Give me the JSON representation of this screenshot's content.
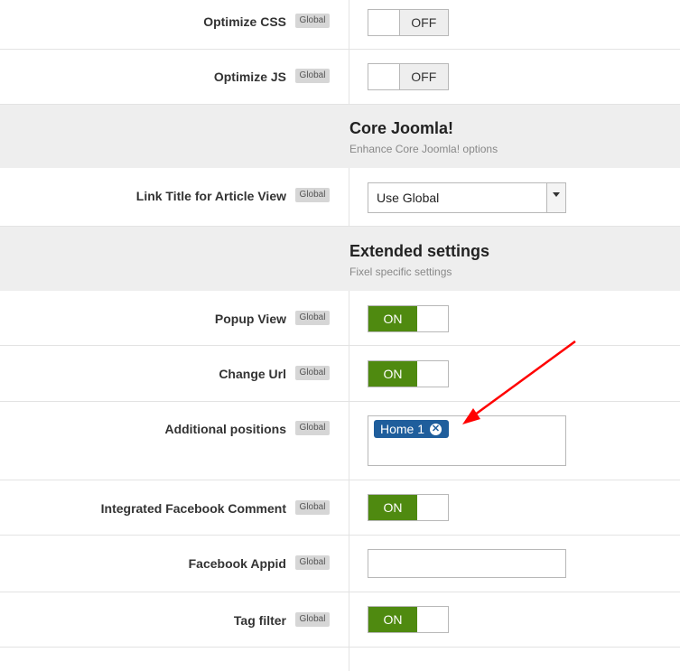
{
  "rows": {
    "optimize_css": {
      "label": "Optimize CSS",
      "badge": "Global",
      "state": "OFF"
    },
    "optimize_js": {
      "label": "Optimize JS",
      "badge": "Global",
      "state": "OFF"
    },
    "link_title": {
      "label": "Link Title for Article View",
      "badge": "Global",
      "value": "Use Global"
    },
    "popup_view": {
      "label": "Popup View",
      "badge": "Global",
      "state": "ON"
    },
    "change_url": {
      "label": "Change Url",
      "badge": "Global",
      "state": "ON"
    },
    "additional_positions": {
      "label": "Additional positions",
      "badge": "Global",
      "chips": [
        "Home 1"
      ]
    },
    "fb_comment": {
      "label": "Integrated Facebook Comment",
      "badge": "Global",
      "state": "ON"
    },
    "fb_appid": {
      "label": "Facebook Appid",
      "badge": "Global",
      "value": ""
    },
    "tag_filter": {
      "label": "Tag filter",
      "badge": "Global",
      "state": "ON"
    }
  },
  "sections": {
    "core": {
      "title": "Core Joomla!",
      "subtitle": "Enhance Core Joomla! options"
    },
    "extended": {
      "title": "Extended settings",
      "subtitle": "Fixel specific settings"
    }
  },
  "colors": {
    "on": "#4f8a10",
    "chip": "#1f5e9c",
    "annotation_arrow": "#ff0000"
  },
  "icons": {
    "chip_remove": "close-circle-icon",
    "dropdown": "caret-down-icon"
  }
}
